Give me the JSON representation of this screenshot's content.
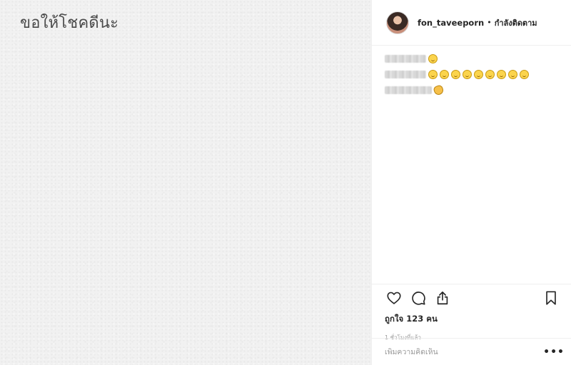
{
  "post": {
    "image_text": "ขอให้โชคดีนะ"
  },
  "header": {
    "username": "fon_taveeporn",
    "separator": "•",
    "follow_status": "กำลังติดตาม"
  },
  "caption": {
    "lines": [
      {
        "emojis": [
          "smiling-face"
        ]
      },
      {
        "emojis": [
          "smiling-face",
          "smiling-face",
          "smiling-face",
          "smiling-face",
          "smiling-face",
          "smiling-face",
          "smiling-face",
          "smiling-face",
          "smiling-face"
        ]
      },
      {
        "emojis": [
          "clapping-hands"
        ]
      }
    ]
  },
  "actions": {
    "icons": [
      "heart-icon",
      "comment-icon",
      "share-icon",
      "bookmark-icon"
    ]
  },
  "likes_text": "ถูกใจ 123 คน",
  "timestamp": "1 ชั่วโมงที่แล้ว",
  "comment": {
    "placeholder": "เพิ่มความคิดเห็น",
    "value": ""
  },
  "more_options": "•••",
  "colors": {
    "text": "#262626",
    "muted": "#999999",
    "border": "#efefef",
    "image_bg": "#f1f1f1"
  }
}
